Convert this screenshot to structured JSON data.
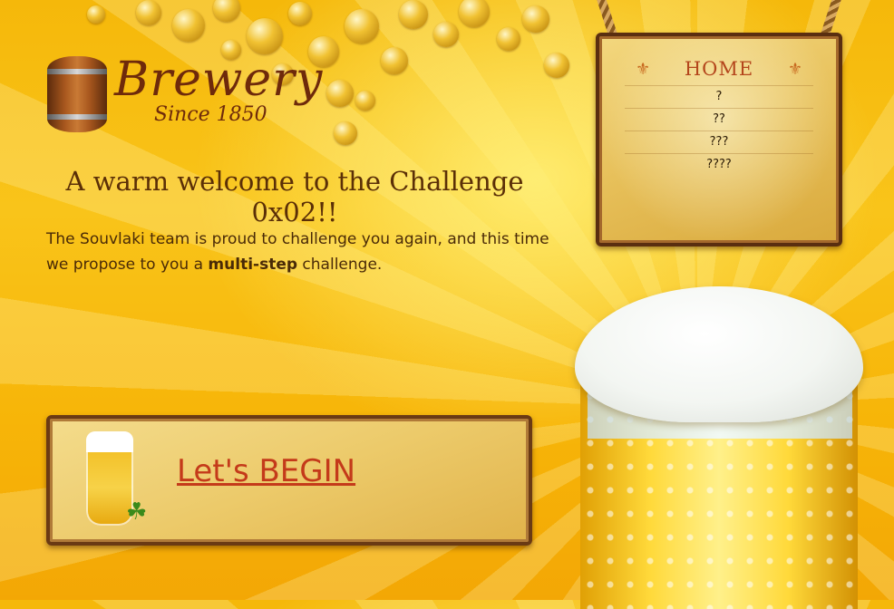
{
  "logo": {
    "name": "Brewery",
    "since": "Since 1850"
  },
  "heading": "A warm welcome to the Challenge 0x02!!",
  "intro": {
    "text_before": "The Souvlaki team is proud to challenge you again, and this time we propose to you a ",
    "bold": "multi-step",
    "text_after": " challenge."
  },
  "menu": {
    "title": "HOME",
    "items": [
      {
        "label": "?"
      },
      {
        "label": "??"
      },
      {
        "label": "???"
      },
      {
        "label": "????"
      }
    ]
  },
  "begin": {
    "link_label": "Let's BEGIN"
  },
  "colors": {
    "link": "#c43a1a",
    "heading": "#5b2f07",
    "menu_title": "#b4461c",
    "background": "#f9c41a"
  },
  "icons": [
    "barrel-icon",
    "fleur-de-lis-icon",
    "beer-glass-icon",
    "clover-icon"
  ]
}
